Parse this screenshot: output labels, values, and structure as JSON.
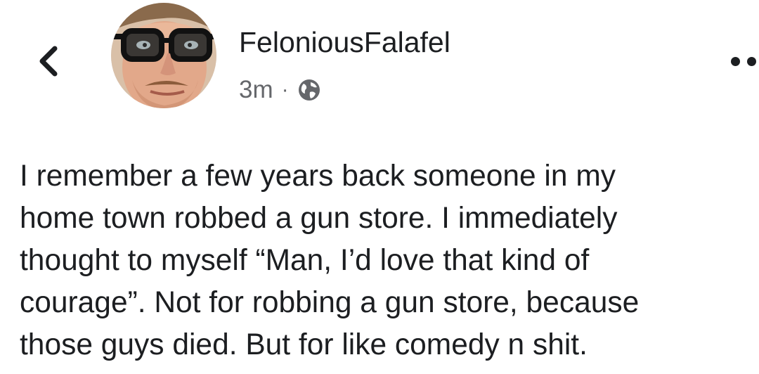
{
  "header": {
    "back_icon": "chevron-left-icon",
    "more_icon": "more-dots-icon"
  },
  "post": {
    "author": "FeloniousFalafel",
    "time": "3m",
    "separator": "·",
    "privacy_icon": "globe-icon",
    "text_lines": [
      "I remember a few years back someone in my",
      "home town robbed a gun store. I immediately",
      "thought to myself “Man, I’d love that kind of",
      "courage”. Not for robbing a gun store, because",
      "those guys died. But for like comedy n shit."
    ]
  }
}
